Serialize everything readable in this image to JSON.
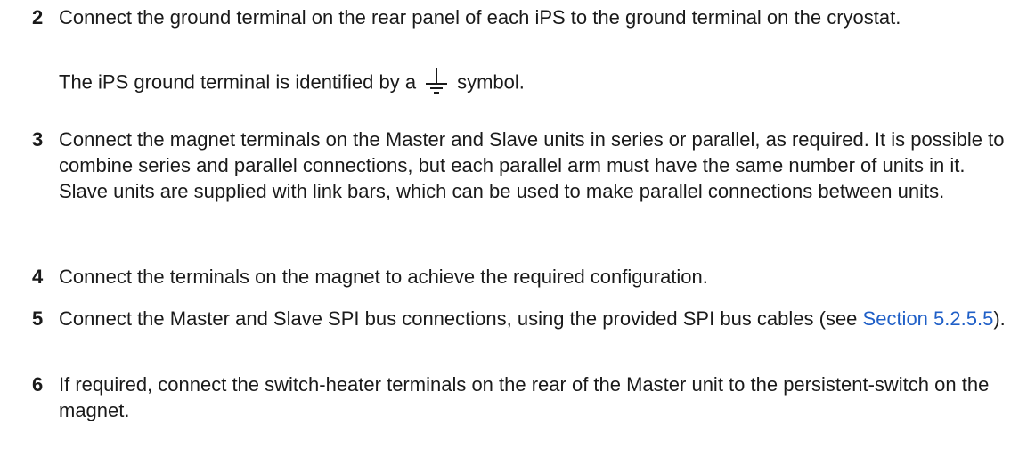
{
  "steps": [
    {
      "number": "2",
      "text": "Connect the ground terminal on the rear panel of each iPS to the ground terminal on the cryostat.",
      "note_before": "The iPS ground terminal is identified by a",
      "note_after": "symbol.",
      "note_icon": "ground-symbol-icon"
    },
    {
      "number": "3",
      "text": "Connect the magnet terminals on the Master and Slave units in series or parallel, as required. It is possible to combine series and parallel connections, but each parallel arm must have the same number of units in it. Slave units are supplied with link bars, which can be used to make parallel connections between units."
    },
    {
      "number": "4",
      "text": "Connect the terminals on the magnet to achieve the required configuration."
    },
    {
      "number": "5",
      "text_before": "Connect the Master and Slave SPI bus connections, using the provided SPI bus cables (see ",
      "link": "Section 5.2.5.5",
      "text_after": ")."
    },
    {
      "number": "6",
      "text": "If required, connect the switch-heater terminals on the rear of the Master unit to the persistent-switch on the magnet."
    }
  ]
}
